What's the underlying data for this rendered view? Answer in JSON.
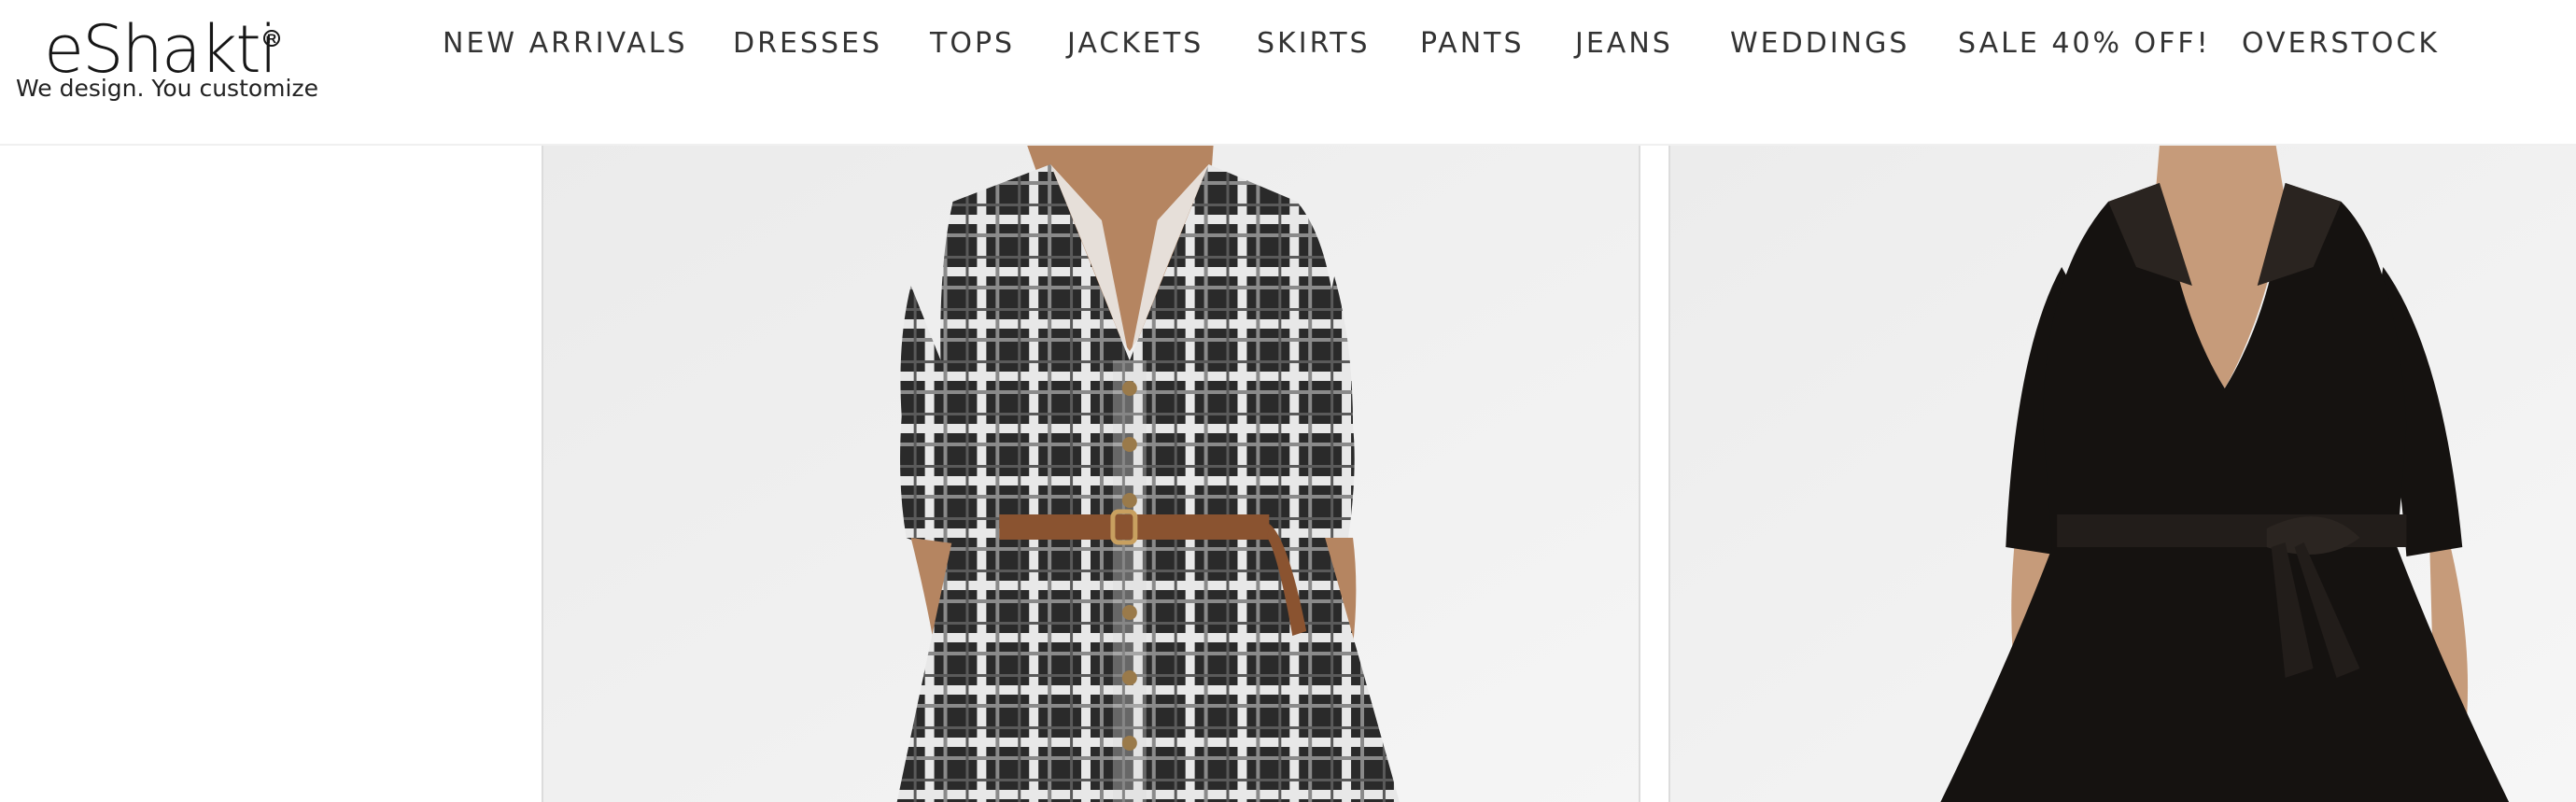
{
  "header": {
    "logo": {
      "wordmark": "eShakti",
      "registered": "R",
      "tagline": "We design. You customize"
    },
    "nav": [
      {
        "label": "NEW ARRIVALS"
      },
      {
        "label": "DRESSES"
      },
      {
        "label": "TOPS"
      },
      {
        "label": "JACKETS"
      },
      {
        "label": "SKIRTS"
      },
      {
        "label": "PANTS"
      },
      {
        "label": "JEANS"
      },
      {
        "label": "WEDDINGS"
      },
      {
        "label": "SALE 40% OFF!"
      },
      {
        "label": "OVERSTOCK"
      }
    ]
  },
  "products": [
    {
      "image_icon": "plaid-shirt-dress-image",
      "dress_color": "#1e1e1e",
      "belt_color": "#8a5330"
    },
    {
      "image_icon": "black-wrap-dress-image",
      "dress_color": "#151210"
    }
  ],
  "colors": {
    "text": "#333333",
    "photo_background": "#f2f2f2",
    "skin": "#b58561"
  }
}
